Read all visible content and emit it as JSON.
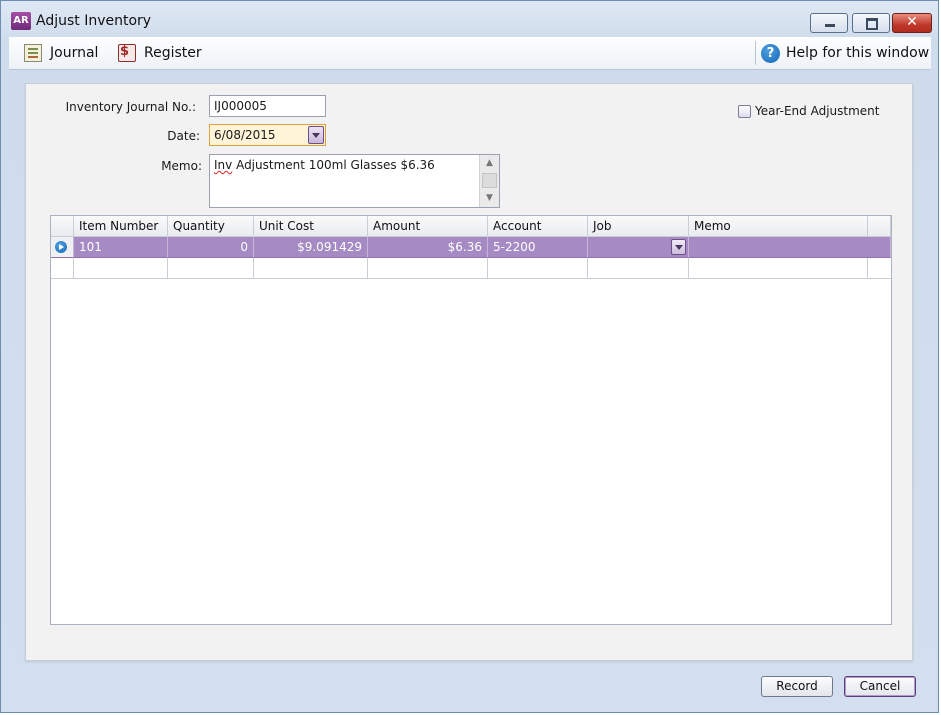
{
  "window": {
    "app_icon_text": "AR",
    "title": "Adjust Inventory",
    "close_glyph": "✕"
  },
  "toolbar": {
    "journal_label": "Journal",
    "register_label": "Register",
    "help_glyph": "?",
    "help_label": "Help for this window"
  },
  "form": {
    "journal_no_label": "Inventory Journal No.:",
    "journal_no_value": "IJ000005",
    "date_label": "Date:",
    "date_value": "6/08/2015",
    "memo_label": "Memo:",
    "memo_value_misspelled": "Inv",
    "memo_value_rest": " Adjustment 100ml Glasses $6.36",
    "year_end_label": "Year-End Adjustment",
    "year_end_checked": false
  },
  "grid": {
    "columns": [
      "Item Number",
      "Quantity",
      "Unit Cost",
      "Amount",
      "Account",
      "Job",
      "Memo"
    ],
    "rows": [
      {
        "item_number": "101",
        "quantity": "0",
        "unit_cost": "$9.091429",
        "amount": "$6.36",
        "account": "5-2200",
        "job": "",
        "memo": ""
      }
    ],
    "selected_row_color": "#a58ac4"
  },
  "buttons": {
    "record_label": "Record",
    "cancel_label": "Cancel"
  },
  "icons": {
    "journal": "journal-icon",
    "register": "register-icon",
    "help": "help-icon",
    "row_pointer": "arrow-right-icon",
    "dropdown": "chevron-down-icon"
  }
}
